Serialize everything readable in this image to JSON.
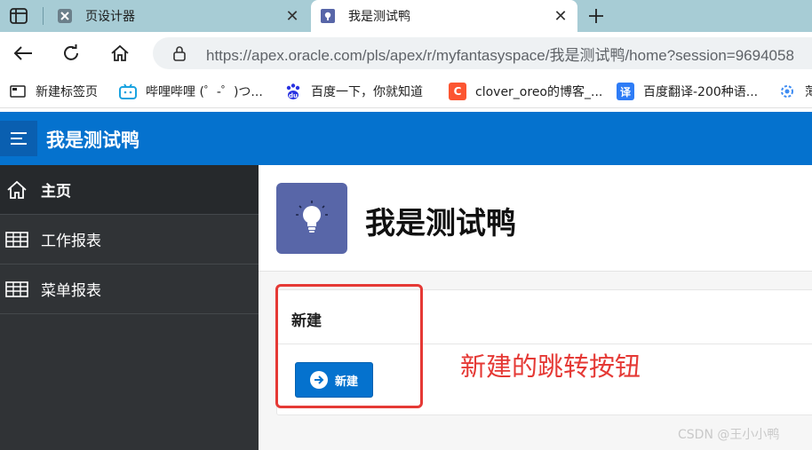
{
  "browser": {
    "tabs": [
      {
        "title": "页设计器",
        "icon": "page-designer-icon",
        "active": false
      },
      {
        "title": "我是测试鸭",
        "icon": "apex-app-icon",
        "active": true
      }
    ],
    "url": "https://apex.oracle.com/pls/apex/r/myfantasyspace/我是测试鸭/home?session=9694058",
    "bookmarks": [
      {
        "label": "新建标签页",
        "icon": "bookmark-icon"
      },
      {
        "label": "哔哩哔哩 (゜-゜)つ...",
        "icon": "bilibili-icon"
      },
      {
        "label": "百度一下，你就知道",
        "icon": "baidu-icon"
      },
      {
        "label": "clover_oreo的博客_...",
        "icon": "csdn-icon"
      },
      {
        "label": "百度翻译-200种语...",
        "icon": "baidu-translate-icon"
      },
      {
        "label": "薄",
        "icon": "gear-icon"
      }
    ]
  },
  "app": {
    "title": "我是测试鸭",
    "nav": [
      {
        "label": "主页",
        "icon": "home-icon",
        "active": true
      },
      {
        "label": "工作报表",
        "icon": "table-icon",
        "active": false
      },
      {
        "label": "菜单报表",
        "icon": "table-icon",
        "active": false
      }
    ],
    "hero_title": "我是测试鸭",
    "region_title": "新建",
    "create_button_label": "新建"
  },
  "annotation": "新建的跳转按钮",
  "watermark": "CSDN @王小小鸭",
  "colors": {
    "header_blue": "#0572ce",
    "sidebar": "#303336",
    "hero_icon_bg": "#5866a8",
    "annotation_red": "#e53935",
    "tabstrip": "#a7ccd5"
  }
}
